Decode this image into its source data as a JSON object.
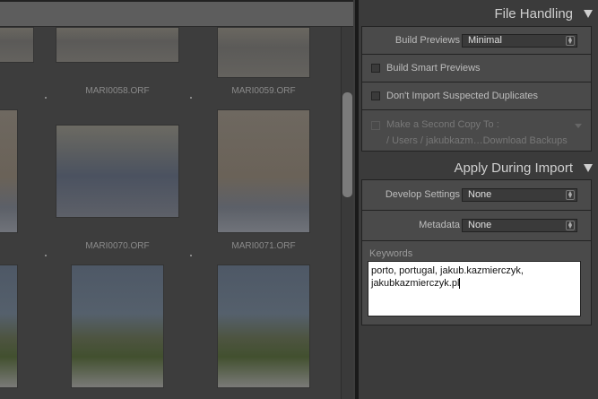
{
  "grid": {
    "thumbnails": [
      {
        "label": "MARI0058.ORF"
      },
      {
        "label": "MARI0059.ORF"
      },
      {
        "label": "MARI0070.ORF"
      },
      {
        "label": "MARI0071.ORF"
      }
    ]
  },
  "file_handling": {
    "title": "File Handling",
    "build_previews_label": "Build Previews",
    "build_previews_value": "Minimal",
    "smart_previews": {
      "label": "Build Smart Previews",
      "checked": false
    },
    "no_duplicates": {
      "label": "Don't Import Suspected Duplicates",
      "checked": false
    },
    "second_copy": {
      "label": "Make a Second Copy To :",
      "path": "/ Users / jakubkazm…Download Backups",
      "checked": false
    }
  },
  "apply_during_import": {
    "title": "Apply During Import",
    "develop_label": "Develop Settings",
    "develop_value": "None",
    "metadata_label": "Metadata",
    "metadata_value": "None",
    "keywords_label": "Keywords",
    "keywords_line1": "porto, portugal, jakub.kazmierczyk,",
    "keywords_line2": "jakubkazmierczyk.pl"
  }
}
